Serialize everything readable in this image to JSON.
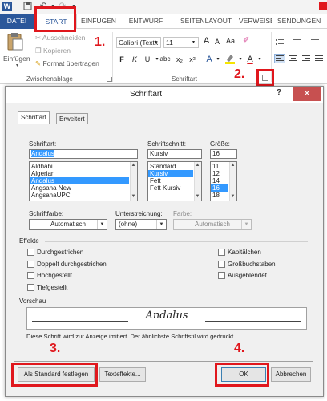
{
  "titlebar": {
    "app_icon": "W",
    "undo_icon": "undo-icon",
    "redo_icon": "redo-icon",
    "save_icon": "save-icon"
  },
  "tabs": [
    "DATEI",
    "START",
    "EINFÜGEN",
    "ENTWURF",
    "SEITENLAYOUT",
    "VERWEISE",
    "SENDUNGEN"
  ],
  "ribbon": {
    "paste_label": "Einfügen",
    "cut_label": "Ausschneiden",
    "copy_label": "Kopieren",
    "format_painter_label": "Format übertragen",
    "clipboard_group": "Zwischenablage",
    "font_name": "Calibri (Textk",
    "font_size": "11",
    "font_group": "Schriftart",
    "bold": "F",
    "italic": "K",
    "underline": "U",
    "strike": "abc",
    "subscript": "x₂",
    "superscript": "x²",
    "grow_font": "A",
    "shrink_font": "A",
    "case": "Aa",
    "text_color": "A",
    "font_color": "A"
  },
  "annotations": {
    "n1": "1.",
    "n2": "2.",
    "n3": "3.",
    "n4": "4."
  },
  "dialog": {
    "title": "Schriftart",
    "help": "?",
    "close": "✕",
    "tab_font": "Schriftart",
    "tab_advanced": "Erweitert",
    "font_label": "Schriftart:",
    "font_value": "Andalus",
    "font_list": [
      "Aldhabi",
      "Algerian",
      "Andalus",
      "Angsana New",
      "AngsanaUPC"
    ],
    "font_selected_index": 2,
    "style_label": "Schriftschnitt:",
    "style_value": "Kursiv",
    "style_list": [
      "Standard",
      "Kursiv",
      "Fett",
      "Fett Kursiv"
    ],
    "style_selected_index": 1,
    "size_label": "Größe:",
    "size_value": "16",
    "size_list": [
      "11",
      "12",
      "14",
      "16",
      "18"
    ],
    "size_selected_index": 3,
    "font_color_label": "Schriftfarbe:",
    "font_color_value": "Automatisch",
    "underline_label": "Unterstreichung:",
    "underline_value": "(ohne)",
    "color_label": "Farbe:",
    "color_value": "Automatisch",
    "effects_label": "Effekte",
    "effects_left": [
      "Durchgestrichen",
      "Doppelt durchgestrichen",
      "Hochgestellt",
      "Tiefgestellt"
    ],
    "effects_right": [
      "Kapitälchen",
      "Großbuchstaben",
      "Ausgeblendet"
    ],
    "preview_label": "Vorschau",
    "preview_text": "Andalus",
    "note": "Diese Schrift wird zur Anzeige imitiert. Der ähnlichste Schriftstil wird gedruckt.",
    "btn_default": "Als Standard festlegen",
    "btn_effects": "Texteffekte...",
    "btn_ok": "OK",
    "btn_cancel": "Abbrechen"
  },
  "colors": {
    "accent": "#2b579a",
    "annotation": "#e0171d",
    "selection": "#3399ff"
  }
}
